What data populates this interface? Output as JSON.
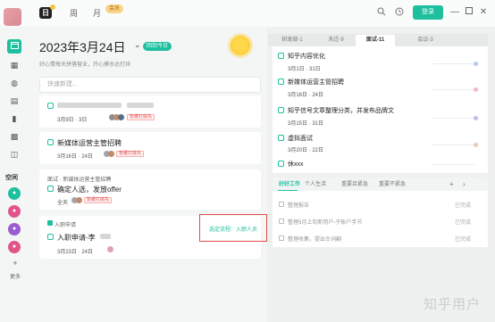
{
  "topbar": {
    "logo_char": "日",
    "tabs": [
      "周",
      "月"
    ],
    "badge": "会员",
    "login_label": "登录",
    "icons": [
      "search-icon",
      "clock-icon",
      "minimize-icon",
      "maximize-icon",
      "close-icon"
    ]
  },
  "sidebar": {
    "icons": [
      "calendar-icon",
      "chart-icon",
      "chat-icon",
      "list-icon",
      "document-icon",
      "grid-icon",
      "layout-icon"
    ],
    "space_label": "空间",
    "spaces": [
      {
        "char": "●",
        "color": "#1dbf9f"
      },
      {
        "char": "●",
        "color": "#e2558a"
      },
      {
        "char": "●",
        "color": "#9a5cd0"
      },
      {
        "char": "●",
        "color": "#e2558a"
      }
    ],
    "more_label": "更多"
  },
  "center": {
    "date_title": "2023年3月24日",
    "today_label": "回到今日",
    "slogan": "好心情每天拼落营业，开心摸水达打烊",
    "add_placeholder": "快速新建...",
    "cards": [
      {
        "meta": "3月9日 · 3日",
        "tag": "暂缓打底先"
      },
      {
        "title": "新媒体运营主管招聘",
        "meta": "3月16日 · 24日",
        "tag": "暂缓打底先"
      },
      {
        "section": "面试 · 新媒体运营主管招聘",
        "title": "确定人选，发放offer",
        "meta": "全天",
        "tag": "暂缓打底先"
      },
      {
        "section": "入职申请",
        "title": "入职申请-李",
        "meta": "3月23日 · 24日"
      }
    ],
    "red_label": "选定流程：入职人员"
  },
  "right": {
    "tabs": [
      "研发部-1",
      "天迁-9",
      "面试-11",
      "会议-3"
    ],
    "active_tab": 2,
    "items": [
      {
        "title": "知乎内容优化",
        "date": "3月1日 · 31日",
        "color": "#b8c9f0"
      },
      {
        "title": "新媒体运营主管招聘",
        "date": "3月16日 · 24日",
        "color": "#f3b8c8"
      },
      {
        "title": "知乎信号文章整理分类，并发布品牌文",
        "date": "3月15日 · 31日",
        "color": "#cbb8f0"
      },
      {
        "title": "虚拟面试",
        "date": "3月20日 · 22日",
        "color": "#f0c8b8"
      },
      {
        "title": "休xxx",
        "date": "",
        "color": "#e0e0e0"
      }
    ],
    "bottom_tabs": [
      "好好工作",
      "个人生活",
      "重要且紧急",
      "重要不紧急",
      "+"
    ],
    "bottom_rows": [
      {
        "text": "整理报告",
        "status": "已完成"
      },
      {
        "text": "整理5月上旬新用户-子账户手节",
        "status": "已完成"
      },
      {
        "text": "整理收集，提出台词翻",
        "status": "已完成"
      }
    ]
  },
  "watermark": "知乎用户"
}
